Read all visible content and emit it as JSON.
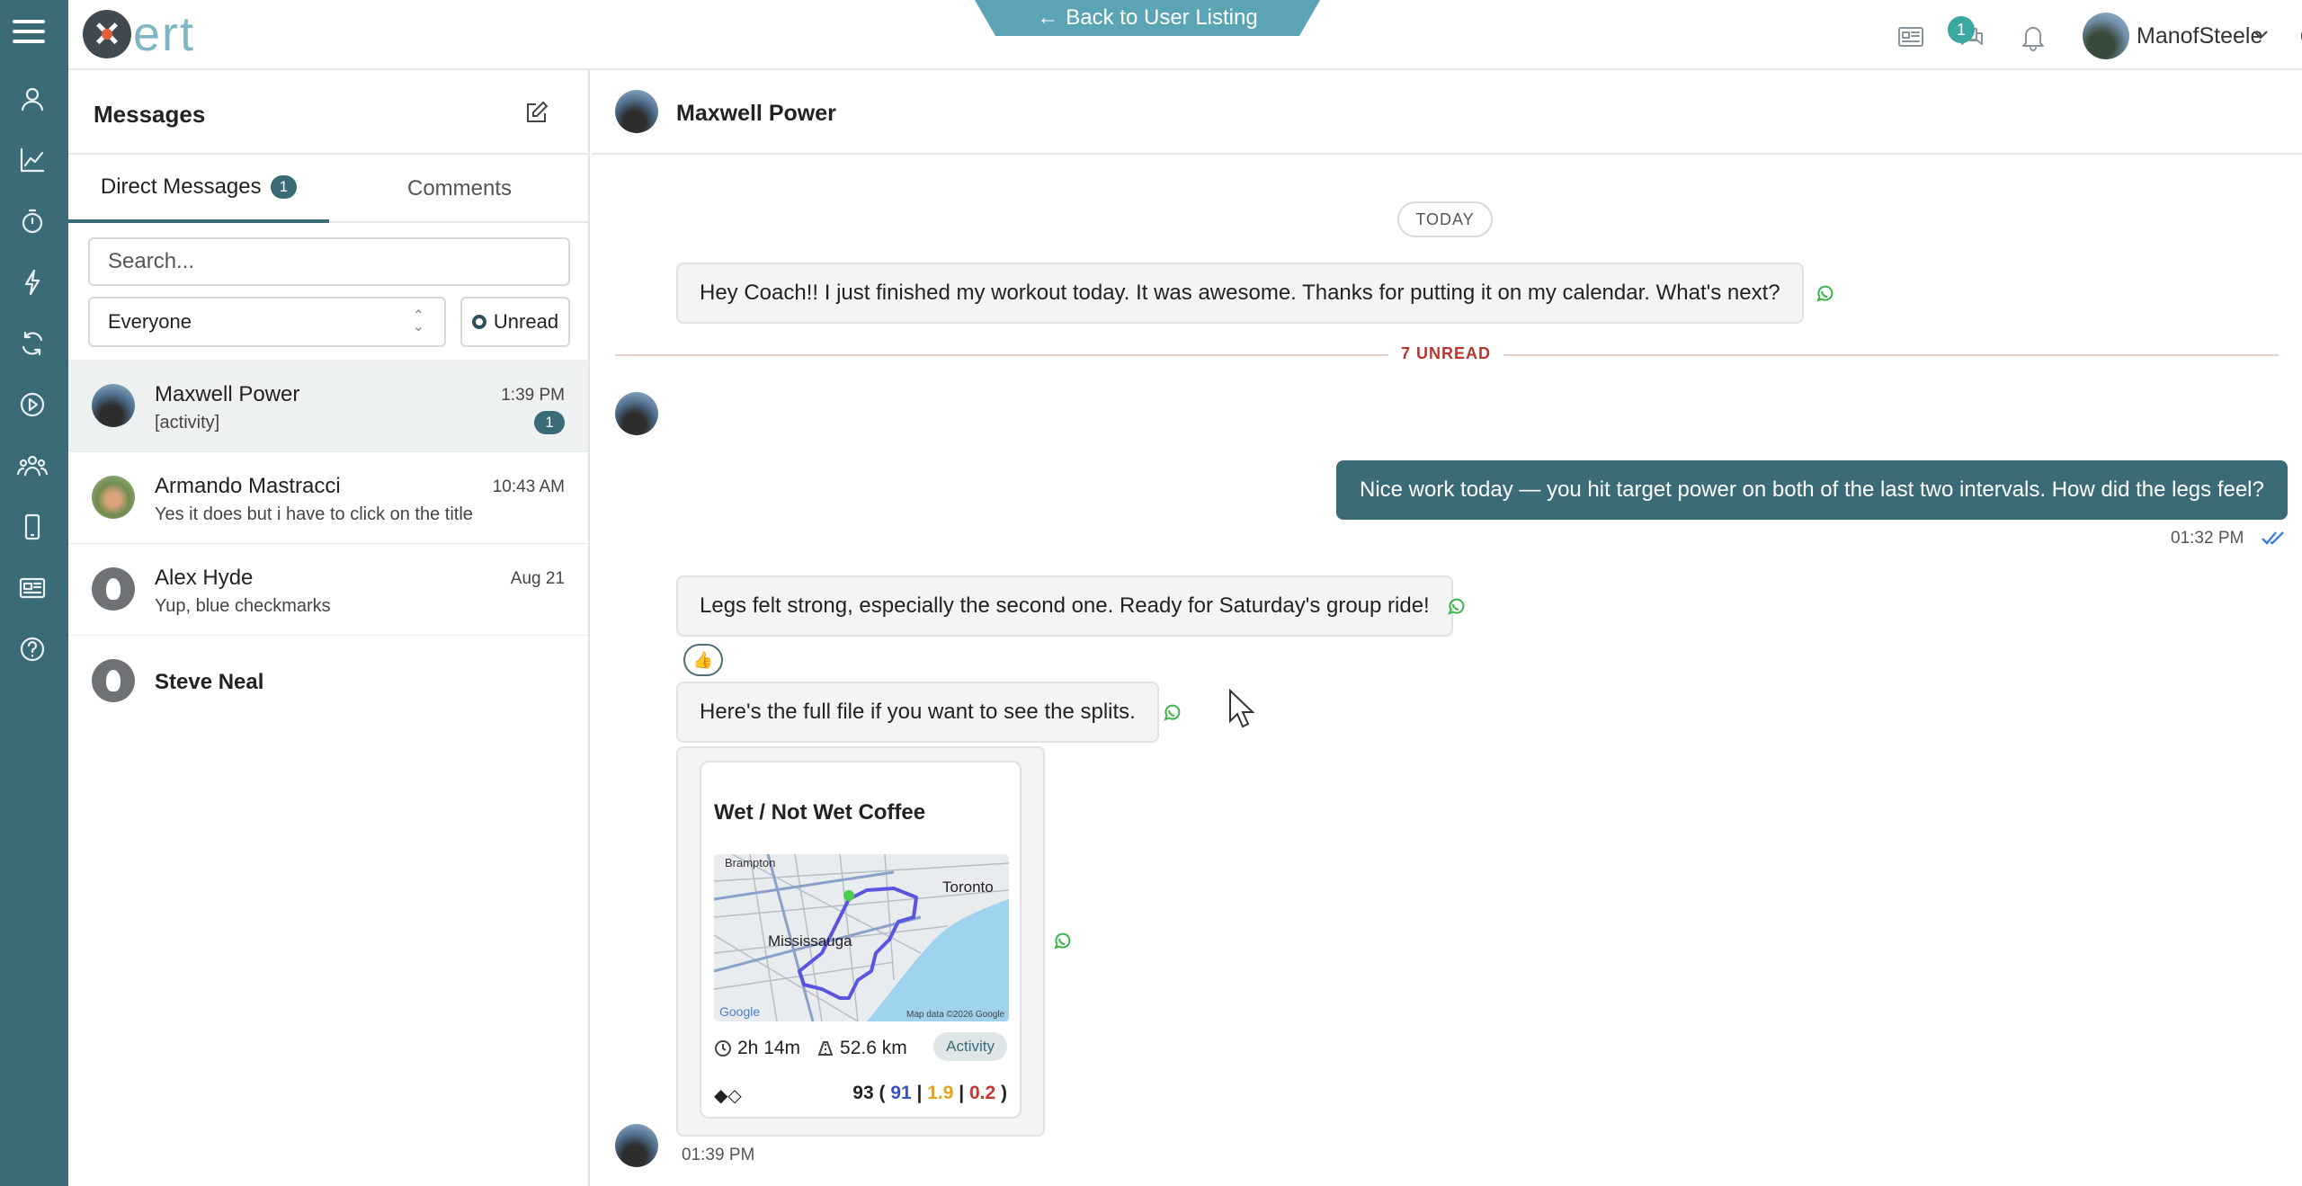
{
  "topbar": {
    "logo_text": "ert",
    "back_label": "Back to User Listing",
    "chat_badge": "1",
    "username": "ManofSteele"
  },
  "sidebar": {
    "title": "Messages",
    "tabs": [
      {
        "label": "Direct Messages",
        "count": "1"
      },
      {
        "label": "Comments"
      }
    ],
    "search_placeholder": "Search...",
    "filter_value": "Everyone",
    "unread_label": "Unread",
    "conversations": [
      {
        "name": "Maxwell Power",
        "preview": "[activity]",
        "time": "1:39 PM",
        "unread": "1"
      },
      {
        "name": "Armando Mastracci",
        "preview": "Yes it does but i have to click on the title",
        "time": "10:43 AM"
      },
      {
        "name": "Alex Hyde",
        "preview": "Yup, blue checkmarks",
        "time": "Aug 21"
      },
      {
        "name": "Steve Neal",
        "preview": "",
        "time": ""
      }
    ]
  },
  "chat": {
    "contact_name": "Maxwell Power",
    "date_divider": "TODAY",
    "unread_divider": "7 UNREAD",
    "messages": [
      {
        "text": "Hey Coach!! I just finished my workout today.  It was awesome.  Thanks for putting it on my calendar.  What's next?"
      },
      {
        "text": "Nice work today — you hit target power on both of the last two intervals. How did the legs feel?",
        "time": "01:32 PM"
      },
      {
        "text": "Legs felt strong, especially the second one. Ready for Saturday's group ride!",
        "reaction": "👍"
      },
      {
        "text": "Here's the full file if you want to see the splits."
      }
    ],
    "activity_card": {
      "title": "Wet / Not Wet Coffee",
      "map_labels": {
        "brampton": "Brampton",
        "toronto": "Toronto",
        "mississauga": "Mississauga",
        "google": "Google",
        "credit": "Map data ©2026 Google"
      },
      "duration": "2h 14m",
      "distance": "52.6 km",
      "badge": "Activity",
      "icons_text": "◆◇",
      "score_total": "93",
      "score_blue": "91",
      "score_yellow": "1.9",
      "score_red": "0.2"
    },
    "last_time": "01:39 PM"
  }
}
